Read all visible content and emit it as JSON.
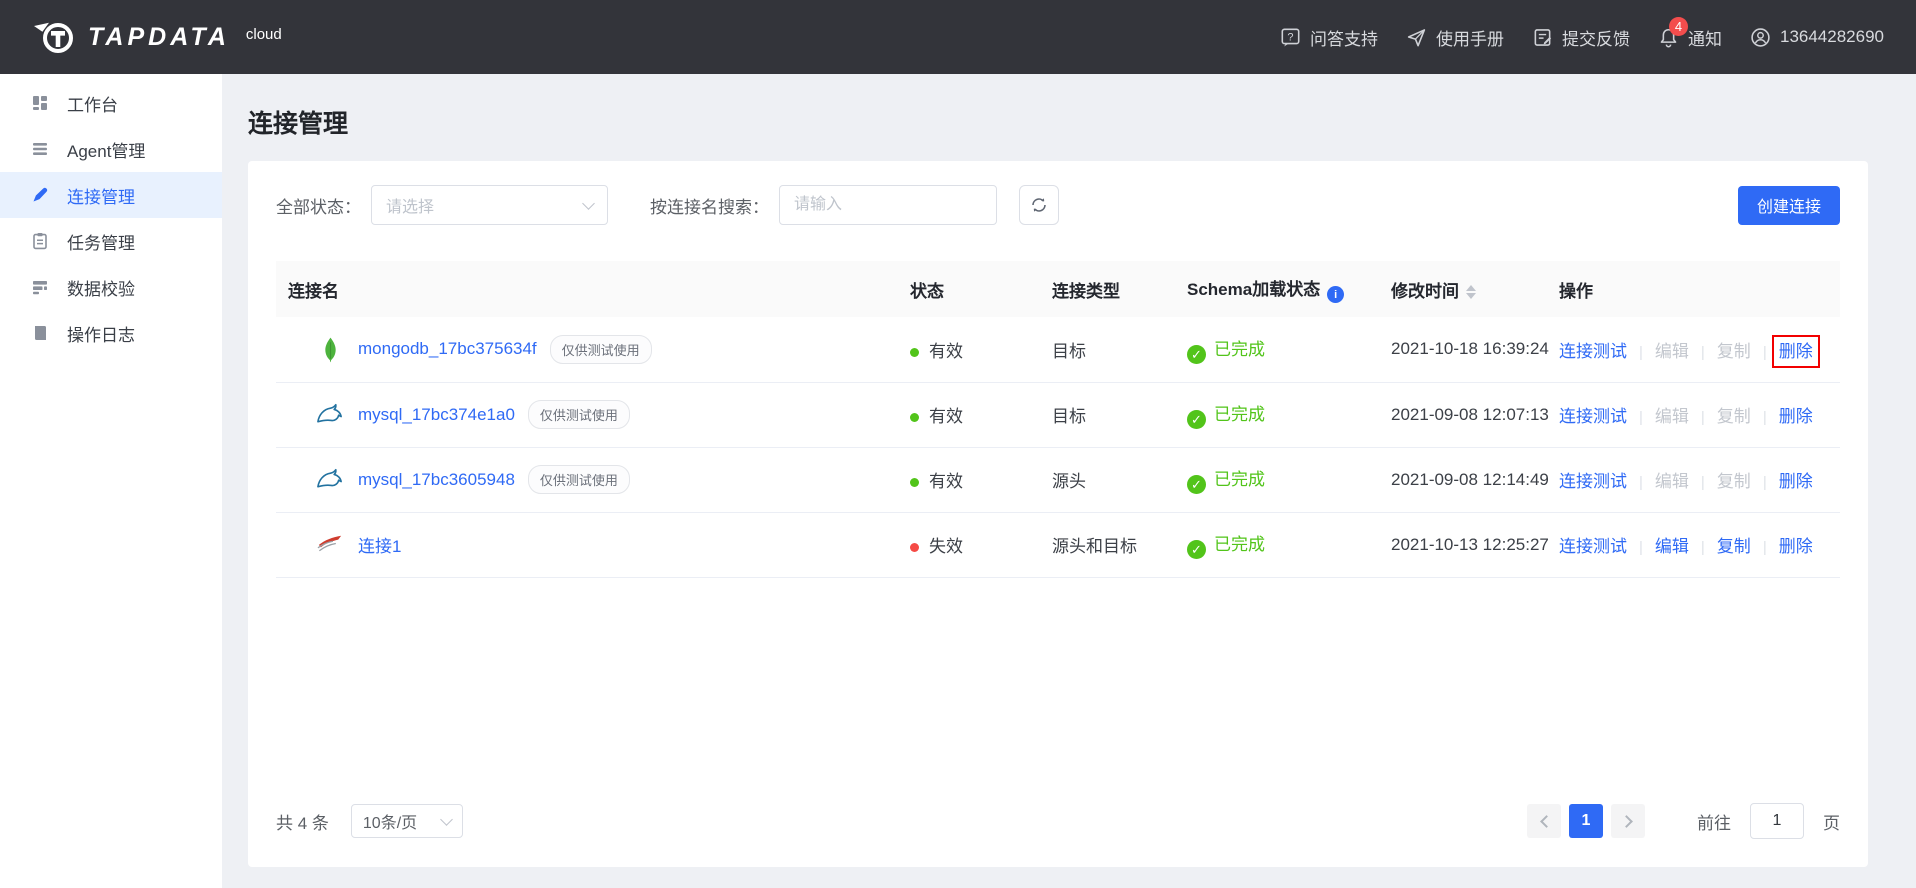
{
  "colors": {
    "header_bg": "#33343a",
    "accent_blue": "#2f6af5",
    "success_green": "#52c41a",
    "invalid_red": "#f54a45",
    "badge_red": "#f34d4d",
    "highlight_box_red": "#f20000"
  },
  "header": {
    "brand": "TAPDATA",
    "brand_suffix": "cloud",
    "nav": [
      {
        "label": "问答支持",
        "icon": "question-icon"
      },
      {
        "label": "使用手册",
        "icon": "paper-plane-icon"
      },
      {
        "label": "提交反馈",
        "icon": "feedback-icon"
      },
      {
        "label": "通知",
        "icon": "bell-icon",
        "badge": "4"
      },
      {
        "label": "13644282690",
        "icon": "user-icon"
      }
    ]
  },
  "sidebar": {
    "items": [
      {
        "label": "工作台",
        "icon": "workbench-icon"
      },
      {
        "label": "Agent管理",
        "icon": "agent-icon"
      },
      {
        "label": "连接管理",
        "icon": "connection-icon",
        "active": true
      },
      {
        "label": "任务管理",
        "icon": "task-icon"
      },
      {
        "label": "数据校验",
        "icon": "data-validation-icon"
      },
      {
        "label": "操作日志",
        "icon": "operation-log-icon"
      }
    ]
  },
  "page": {
    "title": "连接管理"
  },
  "toolbar": {
    "status_label": "全部状态：",
    "status_placeholder": "请选择",
    "search_label": "按连接名搜索：",
    "search_placeholder": "请输入",
    "create_button": "创建连接"
  },
  "table": {
    "columns": [
      "连接名",
      "状态",
      "连接类型",
      "Schema加载状态",
      "修改时间",
      "操作"
    ],
    "rows": [
      {
        "db": "mongodb",
        "name": "mongodb_17bc375634f",
        "badge": "仅供测试使用",
        "status": "有效",
        "status_kind": "valid",
        "type": "目标",
        "schema": "已完成",
        "time": "2021-10-18 16:39:24",
        "actions": [
          {
            "label": "连接测试",
            "state": "enabled"
          },
          {
            "label": "编辑",
            "state": "disabled"
          },
          {
            "label": "复制",
            "state": "disabled"
          },
          {
            "label": "删除",
            "state": "enabled",
            "highlight": "true"
          }
        ]
      },
      {
        "db": "mysql",
        "name": "mysql_17bc374e1a0",
        "badge": "仅供测试使用",
        "status": "有效",
        "status_kind": "valid",
        "type": "目标",
        "schema": "已完成",
        "time": "2021-09-08 12:07:13",
        "actions": [
          {
            "label": "连接测试",
            "state": "enabled"
          },
          {
            "label": "编辑",
            "state": "disabled"
          },
          {
            "label": "复制",
            "state": "disabled"
          },
          {
            "label": "删除",
            "state": "enabled"
          }
        ]
      },
      {
        "db": "mysql",
        "name": "mysql_17bc3605948",
        "badge": "仅供测试使用",
        "status": "有效",
        "status_kind": "valid",
        "type": "源头",
        "schema": "已完成",
        "time": "2021-09-08 12:14:49",
        "actions": [
          {
            "label": "连接测试",
            "state": "enabled"
          },
          {
            "label": "编辑",
            "state": "disabled"
          },
          {
            "label": "复制",
            "state": "disabled"
          },
          {
            "label": "删除",
            "state": "enabled"
          }
        ]
      },
      {
        "db": "sqlserver",
        "name": "连接1",
        "status": "失效",
        "status_kind": "invalid",
        "type": "源头和目标",
        "schema": "已完成",
        "time": "2021-10-13 12:25:27",
        "actions": [
          {
            "label": "连接测试",
            "state": "enabled"
          },
          {
            "label": "编辑",
            "state": "enabled"
          },
          {
            "label": "复制",
            "state": "enabled"
          },
          {
            "label": "删除",
            "state": "enabled"
          }
        ]
      }
    ]
  },
  "pagination": {
    "total": "共 4 条",
    "page_size": "10条/页",
    "current": "1",
    "goto_label": "前往",
    "goto_value": "1",
    "unit_label": "页"
  }
}
